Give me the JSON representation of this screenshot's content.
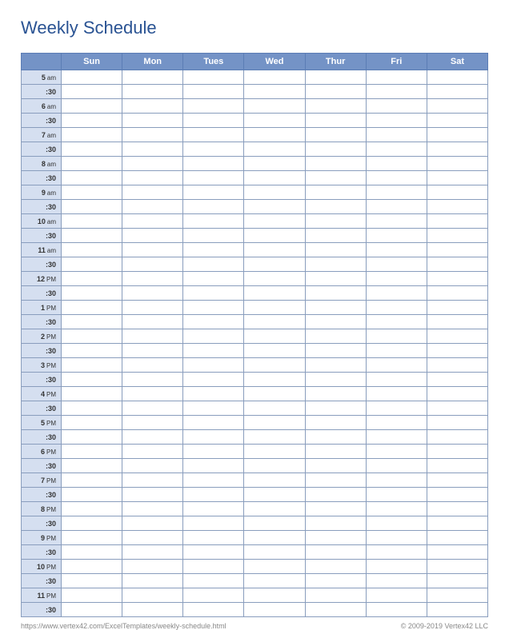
{
  "title": "Weekly Schedule",
  "days": [
    "Sun",
    "Mon",
    "Tues",
    "Wed",
    "Thur",
    "Fri",
    "Sat"
  ],
  "timeRows": [
    {
      "hour": "5",
      "period": "am"
    },
    {
      "half": ":30"
    },
    {
      "hour": "6",
      "period": "am"
    },
    {
      "half": ":30"
    },
    {
      "hour": "7",
      "period": "am"
    },
    {
      "half": ":30"
    },
    {
      "hour": "8",
      "period": "am"
    },
    {
      "half": ":30"
    },
    {
      "hour": "9",
      "period": "am"
    },
    {
      "half": ":30"
    },
    {
      "hour": "10",
      "period": "am"
    },
    {
      "half": ":30"
    },
    {
      "hour": "11",
      "period": "am"
    },
    {
      "half": ":30"
    },
    {
      "hour": "12",
      "period": "PM"
    },
    {
      "half": ":30"
    },
    {
      "hour": "1",
      "period": "PM"
    },
    {
      "half": ":30"
    },
    {
      "hour": "2",
      "period": "PM"
    },
    {
      "half": ":30"
    },
    {
      "hour": "3",
      "period": "PM"
    },
    {
      "half": ":30"
    },
    {
      "hour": "4",
      "period": "PM"
    },
    {
      "half": ":30"
    },
    {
      "hour": "5",
      "period": "PM"
    },
    {
      "half": ":30"
    },
    {
      "hour": "6",
      "period": "PM"
    },
    {
      "half": ":30"
    },
    {
      "hour": "7",
      "period": "PM"
    },
    {
      "half": ":30"
    },
    {
      "hour": "8",
      "period": "PM"
    },
    {
      "half": ":30"
    },
    {
      "hour": "9",
      "period": "PM"
    },
    {
      "half": ":30"
    },
    {
      "hour": "10",
      "period": "PM"
    },
    {
      "half": ":30"
    },
    {
      "hour": "11",
      "period": "PM"
    },
    {
      "half": ":30"
    }
  ],
  "footer": {
    "url": "https://www.vertex42.com/ExcelTemplates/weekly-schedule.html",
    "copyright": "© 2009-2019 Vertex42 LLC"
  }
}
